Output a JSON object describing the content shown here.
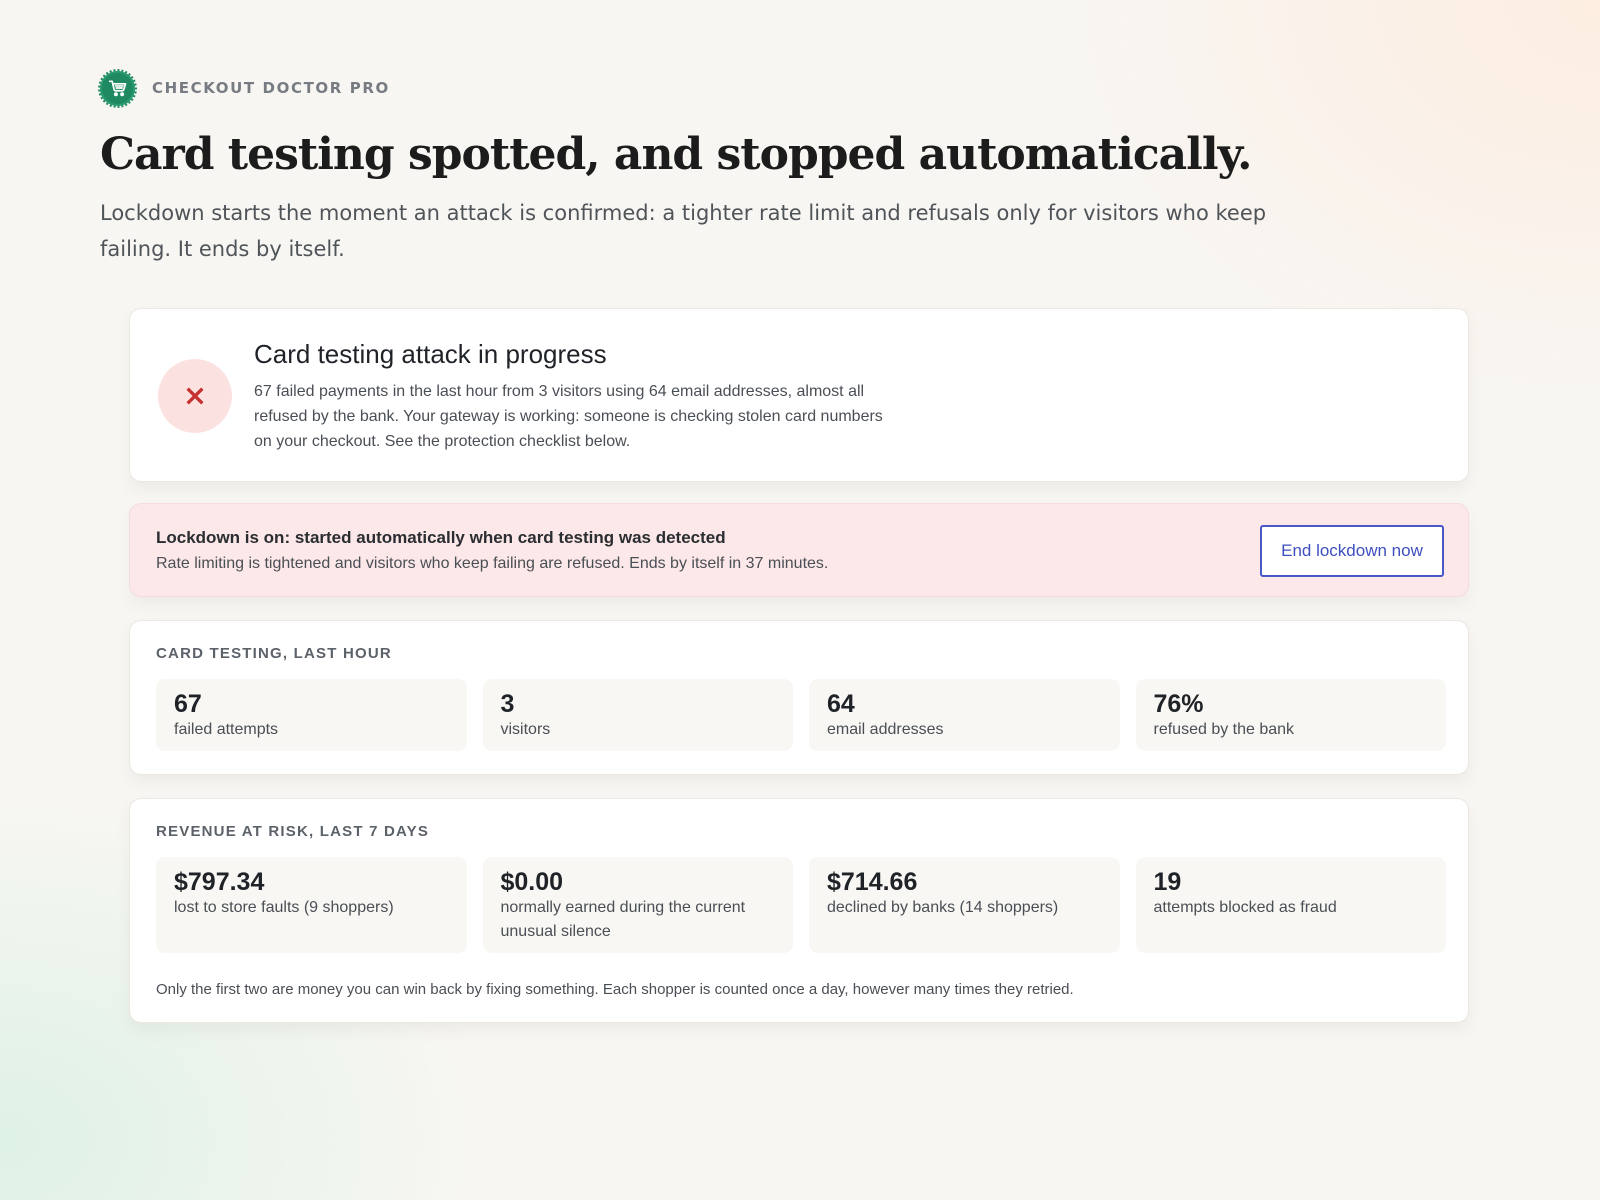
{
  "brand": {
    "name": "CHECKOUT DOCTOR PRO",
    "icon": "shopping-cart-icon",
    "color": "#1f8a62"
  },
  "hero": {
    "headline": "Card testing spotted, and stopped automatically.",
    "lead": "Lockdown starts the moment an attack is confirmed: a tighter rate limit and refusals only for visitors who keep failing. It ends by itself."
  },
  "alert": {
    "icon": "close-icon",
    "title": "Card testing attack in progress",
    "body": "67 failed payments in the last hour from 3 visitors using 64 email addresses, almost all refused by the bank. Your gateway is working: someone is checking stolen card numbers on your checkout. See the protection checklist below.",
    "icon_color": "#c53030"
  },
  "lockdown": {
    "title": "Lockdown is on: started automatically when card testing was detected",
    "body": "Rate limiting is tightened and visitors who keep failing are refused. Ends by itself in 37 minutes.",
    "button_label": "End lockdown now",
    "background_color": "#fce8e8",
    "button_color": "#3e4fc0"
  },
  "card_testing": {
    "label": "CARD TESTING, LAST HOUR",
    "stats": [
      {
        "value": "67",
        "label": "failed attempts"
      },
      {
        "value": "3",
        "label": "visitors"
      },
      {
        "value": "64",
        "label": "email addresses"
      },
      {
        "value": "76%",
        "label": "refused by the bank"
      }
    ]
  },
  "revenue": {
    "label": "REVENUE AT RISK, LAST 7 DAYS",
    "stats": [
      {
        "value": "$797.34",
        "label": "lost to store faults (9 shoppers)"
      },
      {
        "value": "$0.00",
        "label": "normally earned during the current unusual silence"
      },
      {
        "value": "$714.66",
        "label": "declined by banks (14 shoppers)"
      },
      {
        "value": "19",
        "label": "attempts blocked as fraud"
      }
    ],
    "footnote": "Only the first two are money you can win back by fixing something. Each shopper is counted once a day, however many times they retried."
  }
}
